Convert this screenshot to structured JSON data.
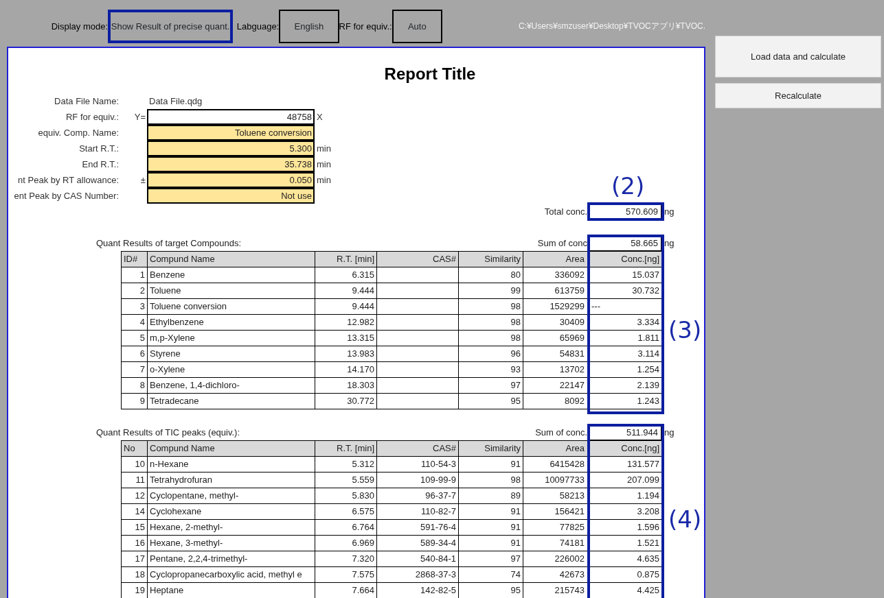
{
  "toolbar": {
    "items": [
      {
        "label": "Display mode:",
        "value": "Show Result of precise quant.",
        "framed": true
      },
      {
        "label": "Labguage:",
        "value": "English",
        "framed": false
      },
      {
        "label": "RF for equiv.:",
        "value": "Auto",
        "framed": false
      }
    ],
    "path": "C:¥Users¥smzuser¥Desktop¥TVOCアプリ¥TVOC."
  },
  "actions": [
    "Load data and calculate",
    "Recalculate"
  ],
  "report": {
    "title": "Report Title",
    "params": [
      {
        "label": "Data File Name:",
        "value": "Data File.qdg",
        "kind": "text"
      },
      {
        "label": "RF for equiv.:",
        "prefix": "Y=",
        "value": "48758",
        "suffix": "X",
        "kind": "input"
      },
      {
        "label": "equiv. Comp. Name:",
        "value": "Toluene conversion",
        "kind": "setting"
      },
      {
        "label": "Start R.T.:",
        "value": "5.300",
        "suffix": "min",
        "kind": "setting"
      },
      {
        "label": "End R.T.:",
        "value": "35.738",
        "suffix": "min",
        "kind": "setting"
      },
      {
        "label": "nt Peak by RT allowance:",
        "prefix": "±",
        "value": "0.050",
        "suffix": "min",
        "kind": "setting"
      },
      {
        "label": "ent Peak by CAS Number:",
        "value": "Not use",
        "kind": "setting"
      }
    ],
    "total": {
      "label": "Total conc.",
      "value": "570.609",
      "unit": "ng",
      "annotation": "(2)"
    },
    "sections": [
      {
        "caption": "Quant Results of target Compounds:",
        "sum_label": "Sum of  conc",
        "sum_value": "58.665",
        "unit": "ng",
        "annotation": "(3)",
        "columns": [
          "ID#",
          "Compund Name",
          "R.T. [min]",
          "CAS#",
          "Similarity",
          "Area",
          "Conc.[ng]"
        ],
        "rows": [
          {
            "no": "1",
            "name": "Benzene",
            "rt": "6.315",
            "similarity": "80",
            "area": "336092",
            "conc": "15.037"
          },
          {
            "no": "2",
            "name": "Toluene",
            "rt": "9.444",
            "similarity": "99",
            "area": "613759",
            "conc": "30.732"
          },
          {
            "no": "3",
            "name": "Toluene conversion",
            "rt": "9.444",
            "similarity": "98",
            "area": "1529299",
            "conc": "---"
          },
          {
            "no": "4",
            "name": "Ethylbenzene",
            "rt": "12.982",
            "similarity": "98",
            "area": "30409",
            "conc": "3.334"
          },
          {
            "no": "5",
            "name": "m,p-Xylene",
            "rt": "13.315",
            "similarity": "98",
            "area": "65969",
            "conc": "1.811"
          },
          {
            "no": "6",
            "name": "Styrene",
            "rt": "13.983",
            "similarity": "96",
            "area": "54831",
            "conc": "3.114"
          },
          {
            "no": "7",
            "name": "o-Xylene",
            "rt": "14.170",
            "similarity": "93",
            "area": "13702",
            "conc": "1.254"
          },
          {
            "no": "8",
            "name": "Benzene, 1,4-dichloro-",
            "rt": "18.303",
            "similarity": "97",
            "area": "22147",
            "conc": "2.139"
          },
          {
            "no": "9",
            "name": "Tetradecane",
            "rt": "30.772",
            "similarity": "95",
            "area": "8092",
            "conc": "1.243"
          }
        ]
      },
      {
        "caption": "Quant Results of TIC peaks (equiv.):",
        "sum_label": "Sum of  conc.",
        "sum_value": "511.944",
        "unit": "ng",
        "annotation": "(4)",
        "columns": [
          "No",
          "Compund Name",
          "R.T. [min]",
          "CAS#",
          "Similarity",
          "Area",
          "Conc.[ng]"
        ],
        "rows": [
          {
            "no": "10",
            "name": "n-Hexane",
            "rt": "5.312",
            "cas": "110-54-3",
            "similarity": "91",
            "area": "6415428",
            "conc": "131.577"
          },
          {
            "no": "11",
            "name": "Tetrahydrofuran",
            "rt": "5.559",
            "cas": "109-99-9",
            "similarity": "98",
            "area": "10097733",
            "conc": "207.099"
          },
          {
            "no": "12",
            "name": "Cyclopentane, methyl-",
            "rt": "5.830",
            "cas": "96-37-7",
            "similarity": "89",
            "area": "58213",
            "conc": "1.194"
          },
          {
            "no": "14",
            "name": "Cyclohexane",
            "rt": "6.575",
            "cas": "110-82-7",
            "similarity": "91",
            "area": "156421",
            "conc": "3.208"
          },
          {
            "no": "15",
            "name": "Hexane, 2-methyl-",
            "rt": "6.764",
            "cas": "591-76-4",
            "similarity": "91",
            "area": "77825",
            "conc": "1.596"
          },
          {
            "no": "16",
            "name": "Hexane, 3-methyl-",
            "rt": "6.969",
            "cas": "589-34-4",
            "similarity": "91",
            "area": "74181",
            "conc": "1.521"
          },
          {
            "no": "17",
            "name": "Pentane, 2,2,4-trimethyl-",
            "rt": "7.320",
            "cas": "540-84-1",
            "similarity": "97",
            "area": "226002",
            "conc": "4.635"
          },
          {
            "no": "18",
            "name": "Cyclopropanecarboxylic acid, methyl e",
            "rt": "7.575",
            "cas": "2868-37-3",
            "similarity": "74",
            "area": "42673",
            "conc": "0.875"
          },
          {
            "no": "19",
            "name": "Heptane",
            "rt": "7.664",
            "cas": "142-82-5",
            "similarity": "95",
            "area": "215743",
            "conc": "4.425"
          }
        ]
      }
    ]
  }
}
